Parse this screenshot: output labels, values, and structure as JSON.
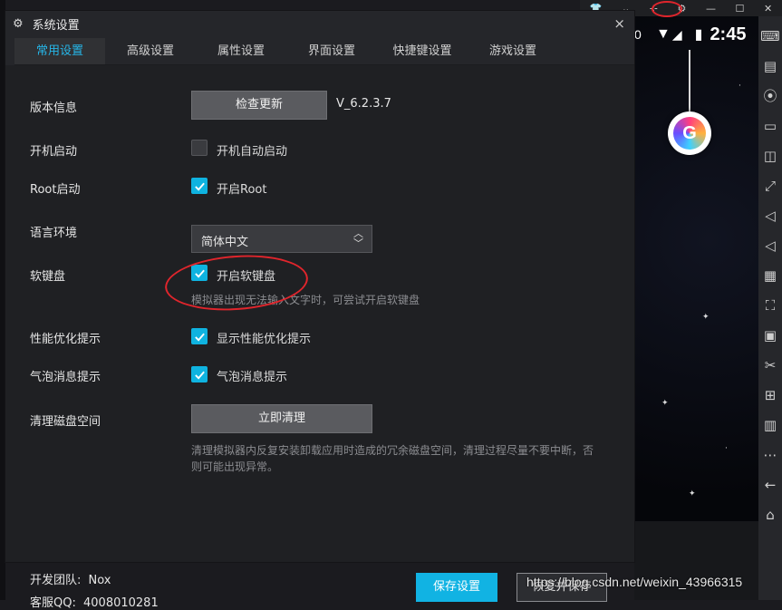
{
  "window": {
    "title": "系统设置",
    "close_symbol": "×",
    "icon": "gear-icon"
  },
  "tabs": [
    {
      "label": "常用设置",
      "active": true
    },
    {
      "label": "高级设置",
      "active": false
    },
    {
      "label": "属性设置",
      "active": false
    },
    {
      "label": "界面设置",
      "active": false
    },
    {
      "label": "快捷键设置",
      "active": false
    },
    {
      "label": "游戏设置",
      "active": false
    }
  ],
  "settings": {
    "version": {
      "label": "版本信息",
      "button": "检查更新",
      "value": "V_6.2.3.7"
    },
    "autostart": {
      "label": "开机启动",
      "checkbox_label": "开机自动启动",
      "checked": false
    },
    "root": {
      "label": "Root启动",
      "checkbox_label": "开启Root",
      "checked": true
    },
    "language": {
      "label": "语言环境",
      "selected": "简体中文"
    },
    "soft_keyboard": {
      "label": "软键盘",
      "checkbox_label": "开启软键盘",
      "checked": true,
      "hint": "模拟器出现无法输入文字时，可尝试开启软键盘"
    },
    "perf_hint": {
      "label": "性能优化提示",
      "checkbox_label": "显示性能优化提示",
      "checked": true
    },
    "bubble_hint": {
      "label": "气泡消息提示",
      "checkbox_label": "气泡消息提示",
      "checked": true
    },
    "disk_clean": {
      "label": "清理磁盘空间",
      "button": "立即清理",
      "hint_line1": "清理模拟器内反复安装卸载应用时造成的冗余磁盘空间，清理过程尽量不要中断，否",
      "hint_line2": "则可能出现异常。"
    }
  },
  "footer": {
    "team_label": "开发团队:",
    "team_value": "Nox",
    "qq_label": "客服QQ:",
    "qq_value": "4008010281",
    "save_button": "保存设置",
    "restore_button": "恢复并保存"
  },
  "emulator": {
    "status_fragment": "0",
    "clock": "2:45",
    "badge_letter": "G"
  },
  "watermark": "https://blog.csdn.net/weixin_43966315",
  "colors": {
    "accent": "#11b3e3",
    "annotation_red": "#e0252c",
    "dialog_bg": "#25262a"
  }
}
